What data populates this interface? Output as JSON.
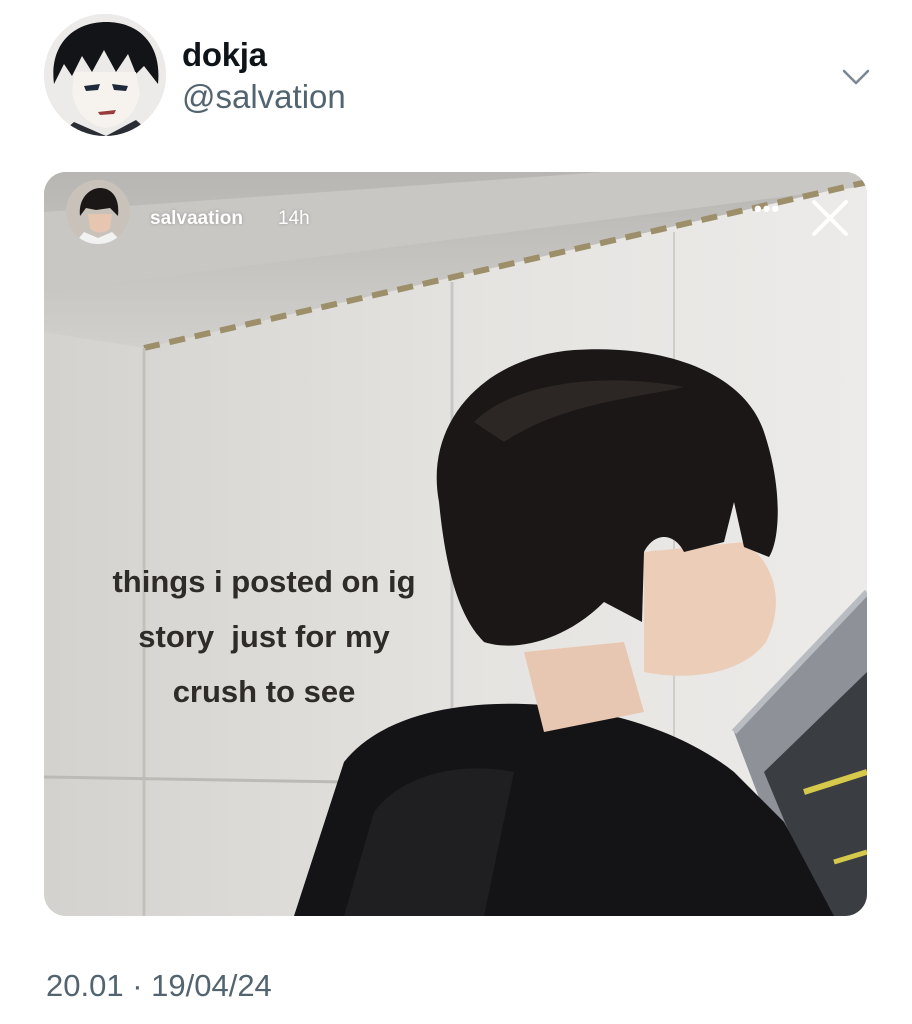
{
  "tweet": {
    "author": {
      "display_name": "dokja",
      "handle": "@salvation",
      "avatar_icon": "manga-character-avatar"
    },
    "more_icon": "chevron-down-icon",
    "media": {
      "type": "instagram-story-screenshot",
      "story_user": "salvaation",
      "story_time": "14h",
      "more_label": "•••",
      "close_icon": "close-icon",
      "caption_lines": [
        "things i posted on ig",
        "story  just for my",
        "crush to see"
      ]
    },
    "timestamp": "20.01 · 19/04/24"
  },
  "colors": {
    "text_primary": "#0f1419",
    "text_secondary": "#536471",
    "background": "#ffffff",
    "caption_text": "#2e2b29"
  }
}
